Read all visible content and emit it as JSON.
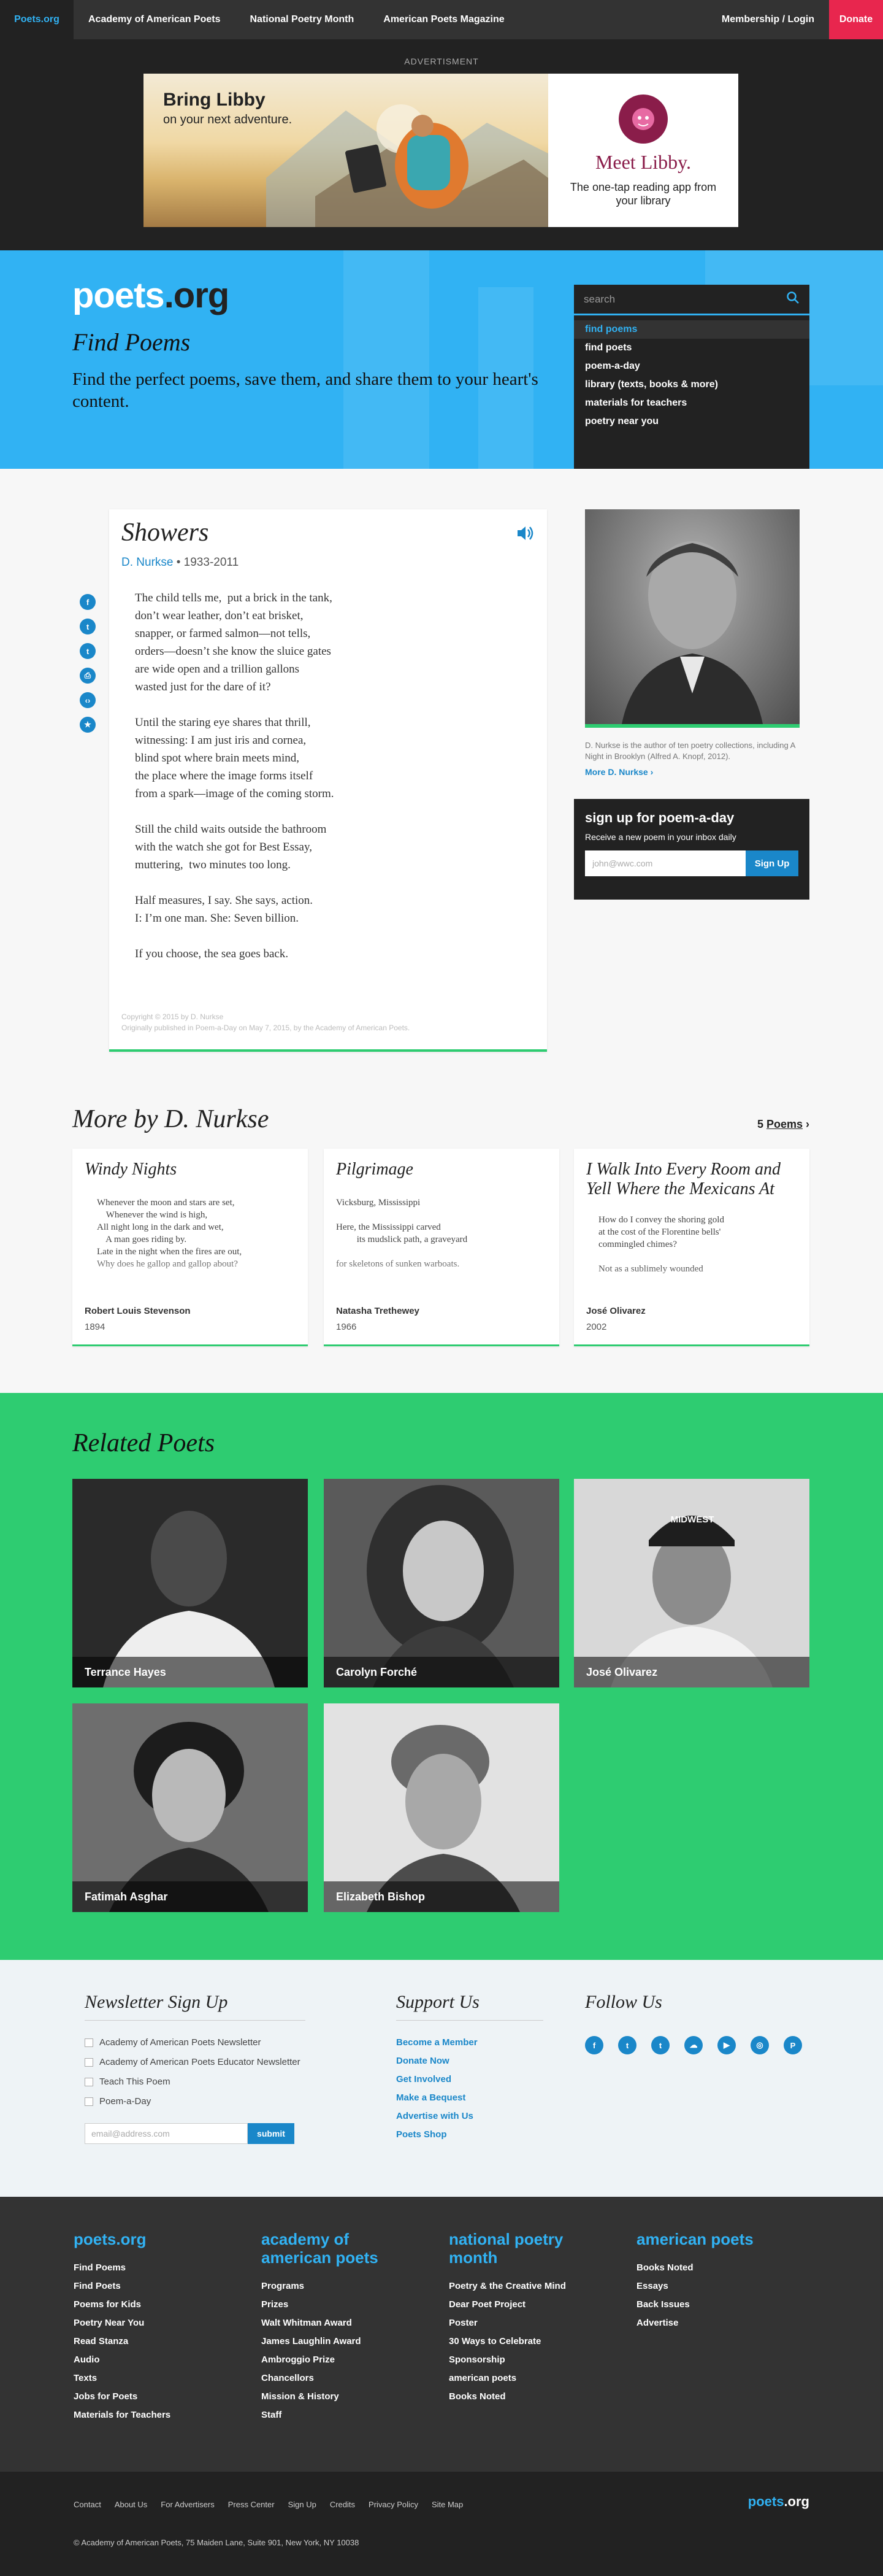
{
  "topnav": {
    "logo": "Poets.org",
    "items": [
      "Academy of American Poets",
      "National Poetry Month",
      "American Poets Magazine"
    ],
    "login": "Membership / Login",
    "donate": "Donate"
  },
  "ad": {
    "label": "ADVERTISMENT",
    "headline": "Bring Libby",
    "subline": "on your next adventure.",
    "meet": "Meet Libby.",
    "tagline": "The one-tap reading app from your library"
  },
  "hero": {
    "brand_a": "poets",
    "brand_b": ".org",
    "find": "Find Poems",
    "tagline": "Find the perfect poems, save them, and share them to your heart's content.",
    "search_placeholder": "search",
    "menu": [
      "find poems",
      "find poets",
      "poem-a-day",
      "library (texts, books & more)",
      "materials for teachers",
      "poetry near you"
    ]
  },
  "poem": {
    "title": "Showers",
    "author": "D. Nurkse",
    "dates": " • 1933-2011",
    "stanzas": [
      [
        "The child tells me,  put a brick in the tank,",
        "don’t wear leather, don’t eat brisket,",
        "snapper, or farmed salmon—not tells,",
        "orders—doesn’t she know the sluice gates",
        "are wide open and a trillion gallons",
        "wasted just for the dare of it?"
      ],
      [
        "Until the staring eye shares that thrill,",
        "witnessing: I am just iris and cornea,",
        "blind spot where brain meets mind,",
        "the place where the image forms itself",
        "from a spark—image of the coming storm."
      ],
      [
        "Still the child waits outside the bathroom",
        "with the watch she got for Best Essay,",
        "muttering,  two minutes too long."
      ],
      [
        "Half measures, I say. She says, action.",
        "I: I’m one man. She: Seven billion."
      ],
      [
        "If you choose, the sea goes back."
      ]
    ],
    "copyright": "Copyright © 2015 by D. Nurkse",
    "originally": "Originally published in Poem-a-Day on May 7, 2015, by the Academy of American Poets."
  },
  "share": [
    "f",
    "t",
    "t",
    "⎙",
    "‹›",
    "★"
  ],
  "author_bio": {
    "caption": "D. Nurkse is the author of ten poetry collections, including A Night in Brooklyn (Alfred A. Knopf, 2012).",
    "more": "More D. Nurkse ›"
  },
  "poemaday": {
    "title": "sign up for poem-a-day",
    "subtitle": "Receive a new poem in your inbox daily",
    "placeholder": "john@wwc.com",
    "button": "Sign Up"
  },
  "more": {
    "heading": "More by D. Nurkse",
    "count": "5",
    "count_label": "Poems",
    "cards": [
      {
        "title": "Windy Nights",
        "excerpt": "Whenever the moon and stars are set,\n    Whenever the wind is high,\nAll night long in the dark and wet,\n    A man goes riding by.\nLate in the night when the fires are out,\nWhy does he gallop and gallop about?",
        "author": "Robert Louis Stevenson",
        "year": "1894"
      },
      {
        "title": "Pilgrimage",
        "excerpt": "Vicksburg, Mississippi\n\nHere, the Mississippi carved\n         its mudslick path, a graveyard\n\nfor skeletons of sunken warboats.",
        "author": "Natasha Trethewey",
        "year": "1966"
      },
      {
        "title": "I Walk Into Every Room and Yell Where the Mexicans At",
        "excerpt": "How do I convey the shoring gold\nat the cost of the Florentine bells'\ncommingled chimes?\n\nNot as a sublimely wounded",
        "author": "José Olivarez",
        "year": "2002"
      }
    ]
  },
  "related": {
    "heading": "Related Poets",
    "poets": [
      "Terrance Hayes",
      "Carolyn Forché",
      "José Olivarez",
      "Fatimah Asghar",
      "Elizabeth Bishop"
    ],
    "cap_text": "MIDWEST"
  },
  "newsletter": {
    "heading": "Newsletter Sign Up",
    "options": [
      "Academy of American Poets Newsletter",
      "Academy of American Poets Educator Newsletter",
      "Teach This Poem",
      "Poem-a-Day"
    ],
    "placeholder": "email@address.com",
    "button": "submit"
  },
  "support": {
    "heading": "Support Us",
    "links": [
      "Become a Member",
      "Donate Now",
      "Get Involved",
      "Make a Bequest",
      "Advertise with Us",
      "Poets Shop"
    ]
  },
  "follow": {
    "heading": "Follow Us",
    "icons": [
      "f",
      "t",
      "t",
      "☁",
      "▶",
      "◎",
      "P"
    ]
  },
  "footer_cols": [
    {
      "heading": "poets.org",
      "items": [
        "Find Poems",
        "Find Poets",
        "Poems for Kids",
        "Poetry Near You",
        "Read Stanza",
        "Audio",
        "Texts",
        "Jobs for Poets",
        "Materials for Teachers"
      ]
    },
    {
      "heading": "academy of american poets",
      "items": [
        "Programs",
        "Prizes",
        "Walt Whitman Award",
        "James Laughlin Award",
        "Ambroggio Prize",
        "Chancellors",
        "Mission & History",
        "Staff"
      ]
    },
    {
      "heading": "national poetry month",
      "items": [
        "Poetry & the Creative Mind",
        "Dear Poet Project",
        "Poster",
        "30 Ways to Celebrate",
        "Sponsorship",
        "american poets",
        "Books Noted"
      ]
    },
    {
      "heading": "american poets",
      "items": [
        "Books Noted",
        "Essays",
        "Back Issues",
        "Advertise"
      ]
    }
  ],
  "footer_bottom": {
    "links": [
      "Contact",
      "About Us",
      "For Advertisers",
      "Press Center",
      "Sign Up",
      "Credits",
      "Privacy Policy",
      "Site Map"
    ],
    "logo_a": "poets",
    "logo_b": ".org",
    "copyright": "© Academy of American Poets, 75 Maiden Lane, Suite 901, New York, NY 10038"
  },
  "colors": {
    "accent": "#31b2f3",
    "link": "#1a87c9",
    "green": "#2ecc71",
    "donate": "#e8264e"
  }
}
